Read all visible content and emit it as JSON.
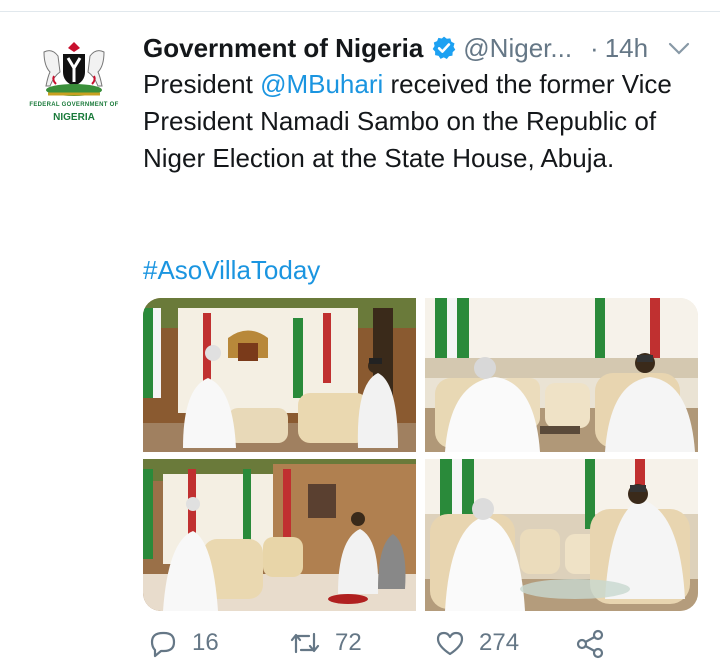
{
  "tweet": {
    "author_name": "Government of Nigeria",
    "handle": "@Niger...",
    "separator": "·",
    "time": "14h",
    "text_before_mention": "President ",
    "mention": "@MBuhari",
    "text_after_mention": " received the former Vice President Namadi Sambo on the Republic of Niger Election at the State House, Abuja.",
    "hashtag": "#AsoVillaToday"
  },
  "avatar": {
    "line1": "FEDERAL GOVERNMENT OF",
    "line2": "NIGERIA"
  },
  "actions": {
    "replies": "16",
    "retweets": "72",
    "likes": "274"
  },
  "icons": {
    "verified": "verified-badge-icon",
    "chevron": "chevron-down-icon",
    "reply": "reply-icon",
    "retweet": "retweet-icon",
    "like": "heart-icon",
    "share": "share-icon"
  },
  "colors": {
    "link": "#1b95e0",
    "muted": "#657786",
    "verified": "#1da1f2"
  }
}
